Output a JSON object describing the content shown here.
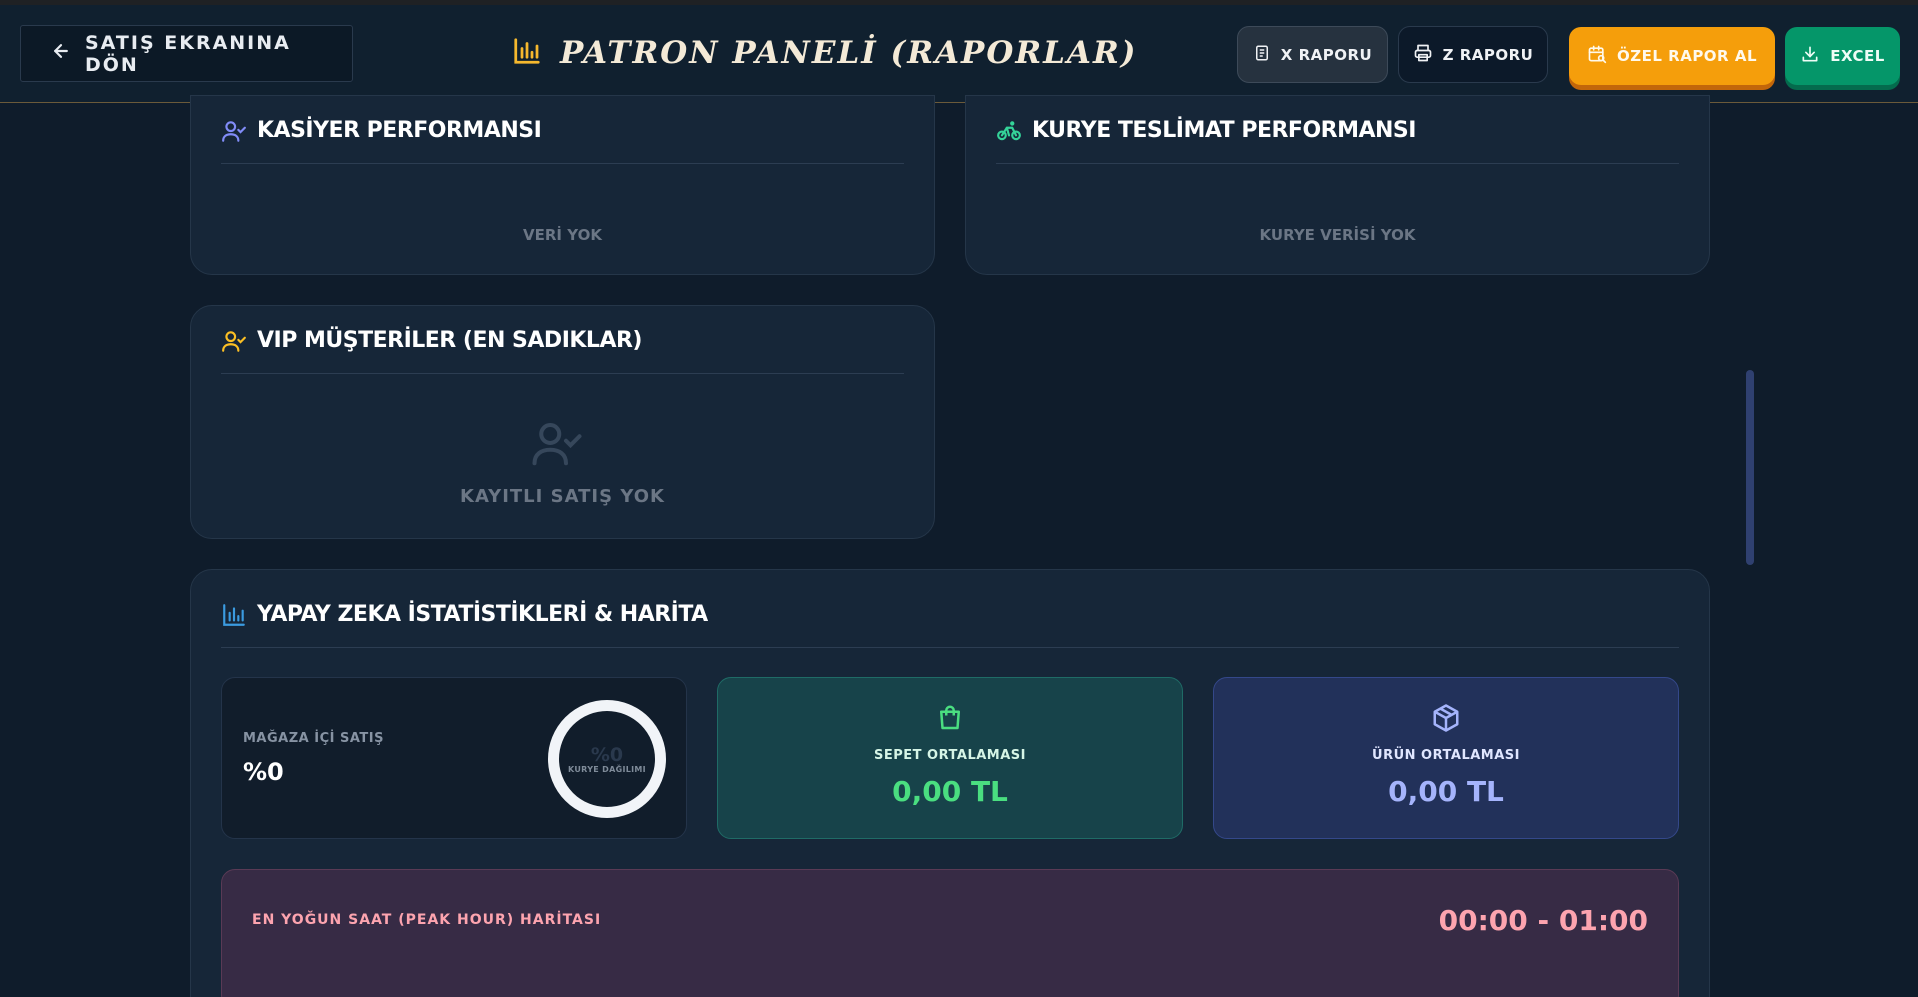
{
  "header": {
    "back_label": "SATIŞ EKRANINA DÖN",
    "title": "PATRON PANELİ (RAPORLAR)",
    "buttons": {
      "x_report": "X RAPORU",
      "z_report": "Z RAPORU",
      "custom_report": "ÖZEL RAPOR AL",
      "excel": "EXCEL"
    }
  },
  "cards": {
    "cashier": {
      "title": "KASİYER PERFORMANSI",
      "empty": "VERİ YOK"
    },
    "courier": {
      "title": "KURYE TESLİMAT PERFORMANSI",
      "empty": "KURYE VERİSİ YOK"
    },
    "vip": {
      "title": "VIP MÜŞTERİLER (EN SADIKLAR)",
      "empty": "KAYITLI SATIŞ YOK"
    },
    "ai": {
      "title": "YAPAY ZEKA İSTATİSTİKLERİ & HARİTA",
      "store_sales": {
        "label": "MAĞAZA İÇİ SATIŞ",
        "value": "%0"
      },
      "courier_ring": {
        "percent": "%0",
        "caption": "KURYE DAĞILIMI"
      },
      "basket_avg": {
        "label": "SEPET ORTALAMASI",
        "value": "0,00 TL"
      },
      "product_avg": {
        "label": "ÜRÜN ORTALAMASI",
        "value": "0,00 TL"
      },
      "peak_hour": {
        "label": "EN YOĞUN SAAT (PEAK HOUR) HARİTASI",
        "value": "00:00 - 01:00"
      }
    }
  },
  "colors": {
    "background": "#0f1c2b",
    "card": "#162638",
    "accent_orange": "#f59e0b",
    "accent_green": "#059669",
    "title_gold": "#f4ead7",
    "basket_teal": "#4ade80",
    "product_indigo": "#a5b4fc",
    "peak_pink": "#fda4af"
  },
  "icons": {
    "back": "arrow-left-icon",
    "title": "bar-chart-icon",
    "x_report": "document-icon",
    "z_report": "printer-icon",
    "custom_report": "calendar-search-icon",
    "excel": "download-icon",
    "cashier": "user-check-icon",
    "courier": "bike-icon",
    "vip": "user-check-icon",
    "ai": "bar-chart-icon",
    "basket": "shopping-bag-icon",
    "product": "box-icon"
  }
}
